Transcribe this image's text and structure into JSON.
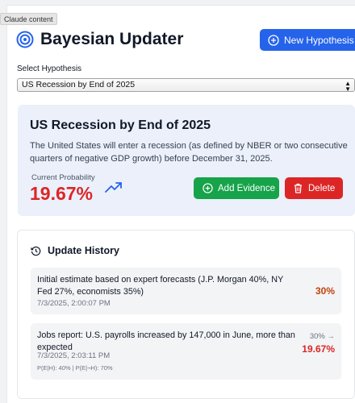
{
  "tooltip": "Claude content",
  "app": {
    "title": "Bayesian Updater",
    "logo_icon": "target-icon"
  },
  "new_hypothesis_button": "New Hypothesis",
  "select": {
    "label": "Select Hypothesis",
    "value": "US Recession by End of 2025"
  },
  "hypothesis": {
    "title": "US Recession by End of 2025",
    "description": "The United States will enter a recession (as defined by NBER or two consecutive quarters of negative GDP growth) before December 31, 2025.",
    "probability_label": "Current Probability",
    "probability": "19.67%",
    "add_evidence": "Add Evidence",
    "delete": "Delete"
  },
  "history": {
    "title": "Update History",
    "entries": [
      {
        "text": "Initial estimate based on expert forecasts (J.P. Morgan 40%, NY Fed 27%, economists 35%)",
        "time": "7/3/2025, 2:00:07 PM",
        "value": "30%"
      },
      {
        "text": "Jobs report: U.S. payrolls increased by 147,000 in June, more than expected",
        "time": "7/3/2025, 2:03:11 PM",
        "meta": "P(E|H): 40% | P(E|¬H): 70%",
        "prev": "30% →",
        "value": "19.67%"
      }
    ]
  },
  "colors": {
    "primary": "#2563eb",
    "success": "#16a34a",
    "danger": "#dc2626",
    "card_bg": "#ebf0fb"
  }
}
